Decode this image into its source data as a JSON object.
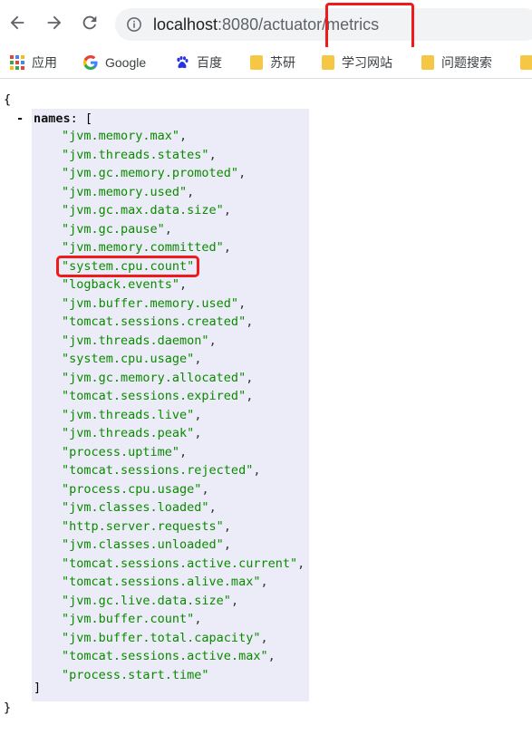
{
  "browser": {
    "url_host": "localhost",
    "url_rest": ":8080/actuator/metrics"
  },
  "bookmarks": [
    {
      "label": "应用",
      "icon": "apps-grid-icon"
    },
    {
      "label": "Google",
      "icon": "google-icon"
    },
    {
      "label": "百度",
      "icon": "baidu-paw-icon"
    },
    {
      "label": "苏研",
      "icon": "folder-icon"
    },
    {
      "label": "学习网站",
      "icon": "folder-icon"
    },
    {
      "label": "问题搜索",
      "icon": "folder-icon"
    }
  ],
  "json_view": {
    "open_brace": "{",
    "close_brace": "}",
    "toggle": "-",
    "key": "names",
    "key_suffix": ": [",
    "close_bracket": "]",
    "names": [
      "\"jvm.memory.max\"",
      "\"jvm.threads.states\"",
      "\"jvm.gc.memory.promoted\"",
      "\"jvm.memory.used\"",
      "\"jvm.gc.max.data.size\"",
      "\"jvm.gc.pause\"",
      "\"jvm.memory.committed\"",
      "\"system.cpu.count\"",
      "\"logback.events\"",
      "\"jvm.buffer.memory.used\"",
      "\"tomcat.sessions.created\"",
      "\"jvm.threads.daemon\"",
      "\"system.cpu.usage\"",
      "\"jvm.gc.memory.allocated\"",
      "\"tomcat.sessions.expired\"",
      "\"jvm.threads.live\"",
      "\"jvm.threads.peak\"",
      "\"process.uptime\"",
      "\"tomcat.sessions.rejected\"",
      "\"process.cpu.usage\"",
      "\"jvm.classes.loaded\"",
      "\"http.server.requests\"",
      "\"jvm.classes.unloaded\"",
      "\"tomcat.sessions.active.current\"",
      "\"tomcat.sessions.alive.max\"",
      "\"jvm.gc.live.data.size\"",
      "\"jvm.buffer.count\"",
      "\"jvm.buffer.total.capacity\"",
      "\"tomcat.sessions.active.max\"",
      "\"process.start.time\""
    ]
  },
  "colors": {
    "string": "#0b8a00",
    "highlight": "#ef1b1b",
    "block_bg": "#ebecf7"
  }
}
